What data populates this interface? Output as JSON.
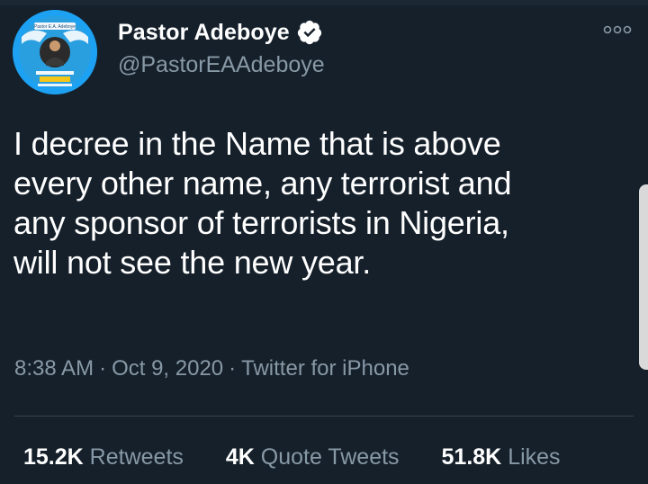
{
  "author": {
    "display_name": "Pastor Adeboye",
    "handle": "@PastorEAAdeboye",
    "verified": true,
    "avatar_banner_text": "Pastor E.A. Adeboye"
  },
  "tweet": {
    "text_lines": [
      "I decree in the Name that is above",
      "every other name, any terrorist and",
      "any sponsor of terrorists in Nigeria,",
      "will not see the new year."
    ],
    "time": "8:38 AM",
    "date": "Oct 9, 2020",
    "source": "Twitter for iPhone",
    "separator": "·"
  },
  "stats": {
    "retweets_count": "15.2K",
    "retweets_label": "Retweets",
    "quote_tweets_count": "4K",
    "quote_tweets_label": "Quote Tweets",
    "likes_count": "51.8K",
    "likes_label": "Likes"
  },
  "colors": {
    "background": "#15202b",
    "text_primary": "#ffffff",
    "text_secondary": "#8899a6",
    "divider": "#38444d",
    "verified_badge": "#ffffff",
    "avatar_accent": "#1da1f2"
  },
  "icons": {
    "verified": "verified-badge-icon",
    "more": "more-options-icon"
  }
}
